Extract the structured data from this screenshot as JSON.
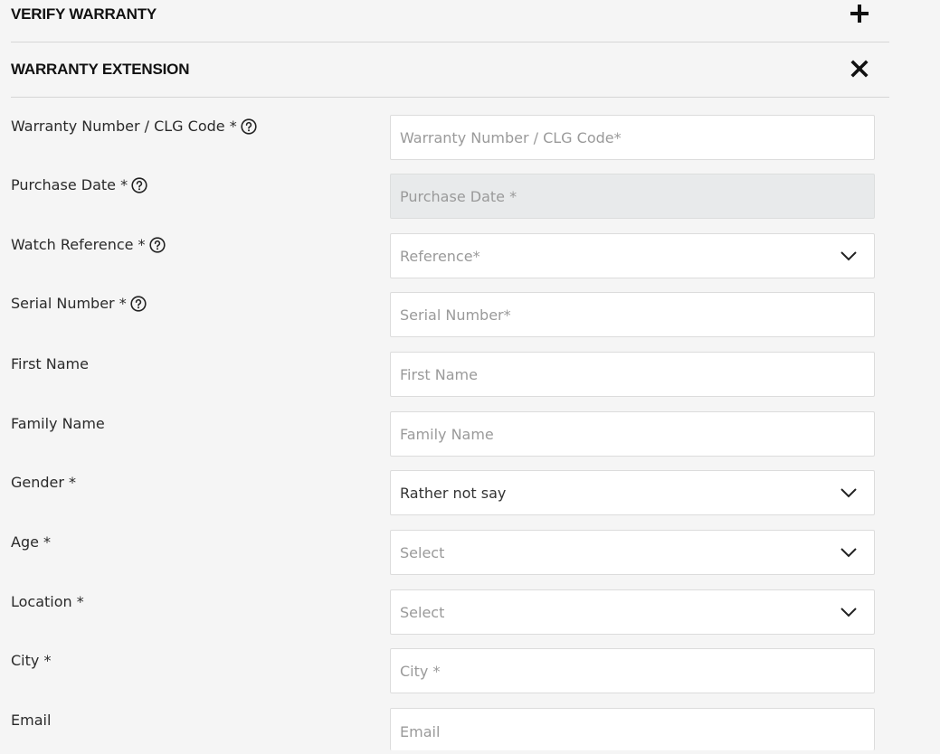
{
  "accordion": {
    "verify": {
      "title": "VERIFY WARRANTY",
      "icon": "plus-icon"
    },
    "extension": {
      "title": "WARRANTY EXTENSION",
      "icon": "close-icon"
    }
  },
  "form": {
    "warranty_number": {
      "label": "Warranty Number / CLG Code *",
      "placeholder": "Warranty Number / CLG Code*",
      "value": ""
    },
    "purchase_date": {
      "label": "Purchase Date *",
      "placeholder": "Purchase Date *",
      "value": ""
    },
    "watch_reference": {
      "label": "Watch Reference *",
      "selected": "Reference*"
    },
    "serial_number": {
      "label": "Serial Number *",
      "placeholder": "Serial Number*",
      "value": ""
    },
    "first_name": {
      "label": "First Name",
      "placeholder": "First Name",
      "value": ""
    },
    "family_name": {
      "label": "Family Name",
      "placeholder": "Family Name",
      "value": ""
    },
    "gender": {
      "label": "Gender *",
      "selected": "Rather not say"
    },
    "age": {
      "label": "Age *",
      "selected": "Select"
    },
    "location": {
      "label": "Location *",
      "selected": "Select"
    },
    "city": {
      "label": "City *",
      "placeholder": "City *",
      "value": ""
    },
    "email": {
      "label": "Email",
      "placeholder": "Email",
      "value": ""
    }
  }
}
